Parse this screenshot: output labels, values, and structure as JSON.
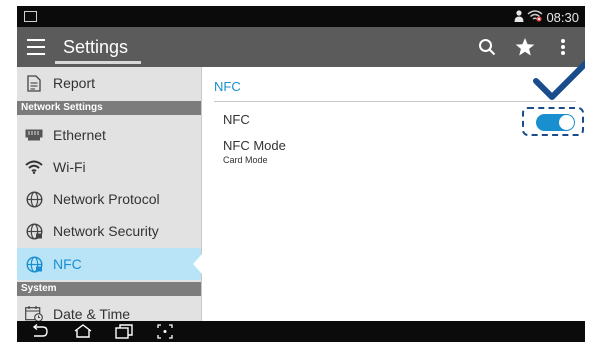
{
  "status_bar": {
    "time": "08:30"
  },
  "app_bar": {
    "title": "Settings"
  },
  "sidebar": {
    "items": [
      {
        "label": "Report"
      },
      {
        "header": "Network Settings"
      },
      {
        "label": "Ethernet"
      },
      {
        "label": "Wi-Fi"
      },
      {
        "label": "Network Protocol"
      },
      {
        "label": "Network Security"
      },
      {
        "label": "NFC"
      },
      {
        "header": "System"
      },
      {
        "label": "Date & Time"
      }
    ]
  },
  "panel": {
    "title": "NFC",
    "nfc_label": "NFC",
    "nfc_enabled": true,
    "mode_label": "NFC Mode",
    "mode_value": "Card Mode"
  },
  "colors": {
    "accent": "#1a8fd0",
    "selected_bg": "#b9e3f7",
    "app_bar": "#5b5b5b",
    "highlight": "#1a4c8c"
  }
}
